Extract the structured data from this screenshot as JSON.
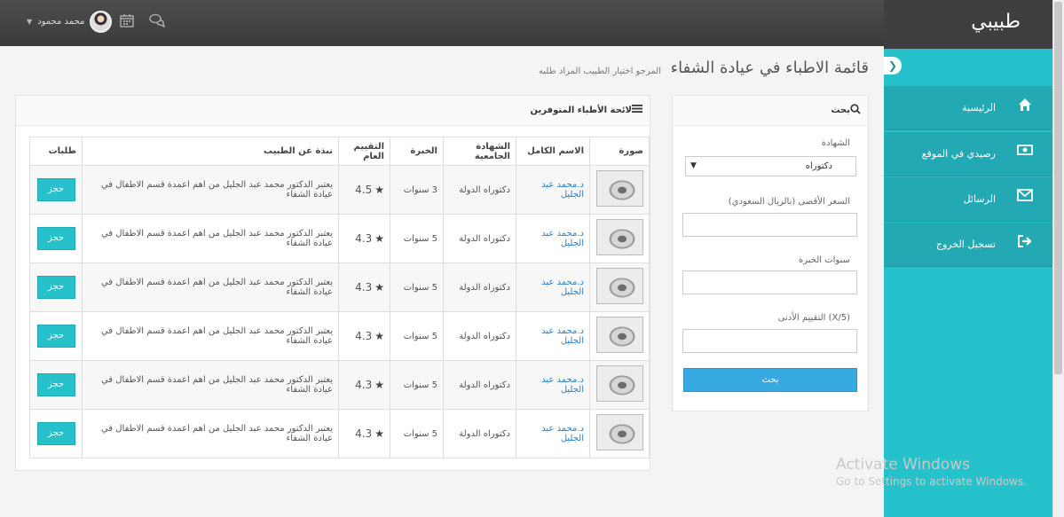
{
  "header": {
    "brand": "طبيبي",
    "user_name": "محمد محمود",
    "icons": [
      "calendar-icon",
      "chat-icon",
      "chevron-down-icon"
    ]
  },
  "sidebar": {
    "items": [
      {
        "label": "الرئيسية",
        "icon": "home-icon"
      },
      {
        "label": "رصيدي في الموقع",
        "icon": "money-icon"
      },
      {
        "label": "الرسائل",
        "icon": "envelope-icon"
      },
      {
        "label": "تسجيل الخروج",
        "icon": "sign-out-icon"
      }
    ]
  },
  "page": {
    "title": "قائمة الاطباء في عيادة الشفاء",
    "subtitle": "المرجو اختيار الطبيب المراد طلبه"
  },
  "filter": {
    "heading": "بحث",
    "degree_label": "الشهادة",
    "degree_selected": "دكتوراه",
    "max_price_label": "السعر الأقصى (بالريال السعودي)",
    "experience_label": "سنوات الخبرة",
    "min_rating_label": "التقييم الأدنى (X/5)",
    "search_button": "بحث"
  },
  "table": {
    "heading": "لائحة الأطباء المتوفرين",
    "columns": [
      "صورة",
      "الاسم الكامل",
      "الشهادة الجامعية",
      "الخبرة",
      "التقييم العام",
      "نبذة عن الطبيب",
      "طلبات"
    ],
    "book_label": "حجز",
    "rows": [
      {
        "name": "د.محمد عبد الجليل",
        "degree": "دكتوراه الدولة",
        "experience": "3 سنوات",
        "rating": "4.5",
        "bio": "يعتبر الدكتور محمد عبد الجليل من اهم اعمدة قسم الاطفال في عيادة الشفاء"
      },
      {
        "name": "د.محمد عبد الجليل",
        "degree": "دكتوراه الدولة",
        "experience": "5 سنوات",
        "rating": "4.3",
        "bio": "يعتبر الدكتور محمد عبد الجليل من اهم اعمدة قسم الاطفال في عيادة الشفاء"
      },
      {
        "name": "د.محمد عبد الجليل",
        "degree": "دكتوراه الدولة",
        "experience": "5 سنوات",
        "rating": "4.3",
        "bio": "يعتبر الدكتور محمد عبد الجليل من اهم اعمدة قسم الاطفال في عيادة الشفاء"
      },
      {
        "name": "د.محمد عبد الجليل",
        "degree": "دكتوراه الدولة",
        "experience": "5 سنوات",
        "rating": "4.3",
        "bio": "يعتبر الدكتور محمد عبد الجليل من اهم اعمدة قسم الاطفال في عيادة الشفاء"
      },
      {
        "name": "د.محمد عبد الجليل",
        "degree": "دكتوراه الدولة",
        "experience": "5 سنوات",
        "rating": "4.3",
        "bio": "يعتبر الدكتور محمد عبد الجليل من اهم اعمدة قسم الاطفال في عيادة الشفاء"
      },
      {
        "name": "د.محمد عبد الجليل",
        "degree": "دكتوراه الدولة",
        "experience": "5 سنوات",
        "rating": "4.3",
        "bio": "يعتبر الدكتور محمد عبد الجليل من اهم اعمدة قسم الاطفال في عيادة الشفاء"
      }
    ]
  },
  "watermark": {
    "line1": "Activate Windows",
    "line2": "Go to Settings to activate Windows."
  },
  "colors": {
    "sidebar": "#26c2cc",
    "sidebar_item": "#23a9b3",
    "topbar": "#444444",
    "search_button": "#36a9e1",
    "book_button": "#27c1cb",
    "link": "#2b7fc0"
  }
}
